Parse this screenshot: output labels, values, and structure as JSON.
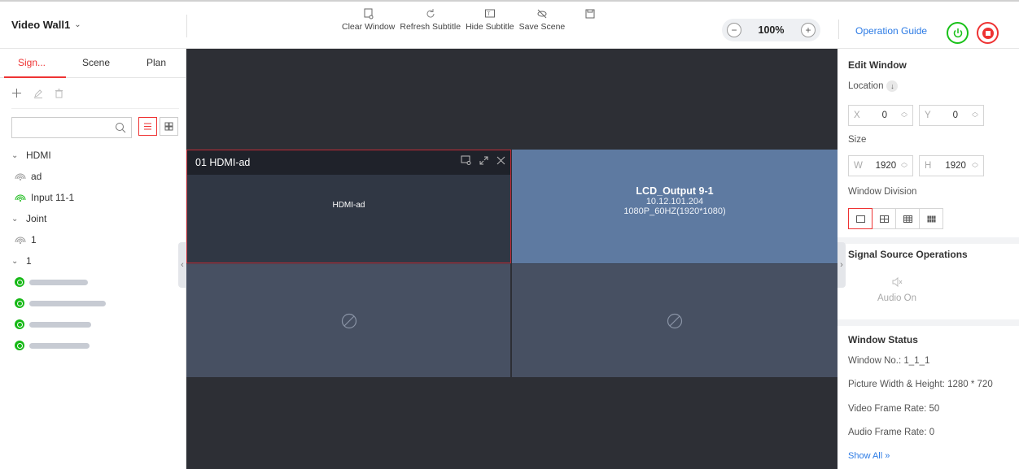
{
  "topbar": {
    "wall_name": "Video Wall1",
    "tools": [
      {
        "label": "Clear Window",
        "icon": "clear-window-icon"
      },
      {
        "label": "Refresh Subtitle",
        "icon": "refresh-icon"
      },
      {
        "label": "Hide Subtitle",
        "icon": "subtitle-icon"
      },
      {
        "label": "Save Scene",
        "icon": "hide-icon"
      },
      {
        "label": "",
        "icon": "save-icon"
      }
    ],
    "tool_labels": [
      "Clear Window",
      "Refresh Subtitle",
      "Hide Subtitle",
      "Save Scene"
    ],
    "zoom": "100%",
    "operation_guide": "Operation Guide"
  },
  "left": {
    "tabs": [
      "Sign...",
      "Scene",
      "Plan"
    ],
    "search_placeholder": "",
    "tree": {
      "hdmi": {
        "label": "HDMI",
        "children": [
          "ad",
          "Input 11-1"
        ]
      },
      "joint": {
        "label": "Joint",
        "children": [
          "1"
        ]
      },
      "group1": {
        "label": "1"
      }
    }
  },
  "canvas": {
    "window1": {
      "title": "01 HDMI-ad",
      "content": "HDMI-ad"
    },
    "window2": {
      "name": "LCD_Output 9-1",
      "ip": "10.12.101.204",
      "resolution": "1080P_60HZ(1920*1080)"
    }
  },
  "right": {
    "edit_window": "Edit Window",
    "location": "Location",
    "x_label": "X",
    "x_value": "0",
    "y_label": "Y",
    "y_value": "0",
    "size": "Size",
    "w_label": "W",
    "w_value": "1920",
    "h_label": "H",
    "h_value": "1920",
    "window_division": "Window Division",
    "signal_ops": "Signal Source Operations",
    "audio_on": "Audio On",
    "window_status": "Window Status",
    "window_no": "Window No.:  1_1_1",
    "picture_size": "Picture Width & Height:  1280 * 720",
    "video_rate": "Video Frame Rate:  50",
    "audio_rate": "Audio Frame Rate:  0",
    "show_all": "Show All »"
  },
  "colors": {
    "accent": "#e33333",
    "link": "#2c7be5",
    "power_on": "#19c119",
    "selected_window": "#5e7aa1"
  }
}
